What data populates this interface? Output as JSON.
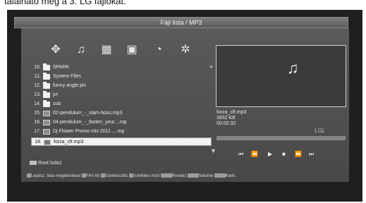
{
  "caption": "található meg a 3. LG fájlokat.",
  "window": {
    "title": "Fájl lista / MP3"
  },
  "filter_icons": [
    {
      "name": "all-files-icon",
      "glyph": "✥"
    },
    {
      "name": "music-icon",
      "glyph": "♫"
    },
    {
      "name": "video-icon",
      "glyph": "▦"
    },
    {
      "name": "photo-icon",
      "glyph": "▣"
    },
    {
      "name": "text-icon",
      "glyph": "◔"
    },
    {
      "name": "settings-icon",
      "glyph": "✲"
    }
  ],
  "files": [
    {
      "num": "10.",
      "type": "folder",
      "name": "SPARK"
    },
    {
      "num": "11.",
      "type": "folder",
      "name": "System Files"
    },
    {
      "num": "12.",
      "type": "folder",
      "name": "funny angle pix"
    },
    {
      "num": "13.",
      "type": "folder",
      "name": "jvr"
    },
    {
      "num": "14.",
      "type": "folder",
      "name": "sub"
    },
    {
      "num": "15.",
      "type": "mp3",
      "name": "02-pendulum_-_slam-boss.mp3"
    },
    {
      "num": "16.",
      "type": "mp3",
      "name": "04-pendulum_-_fasten_your....mp"
    },
    {
      "num": "17.",
      "type": "mp3",
      "name": "Dj Flower Promo mix 2011 ....mp"
    },
    {
      "num": "18.",
      "type": "mp3",
      "name": "forza_cfr.mp3",
      "selected": true
    }
  ],
  "scroll": {
    "up": "▲",
    "down": "▼"
  },
  "now_playing": {
    "file": "forza_cfr.mp3",
    "size": "3652 KB",
    "time": "00:02:32",
    "progress": 0.0
  },
  "brand": "LGL",
  "controls": [
    {
      "name": "prev-track-icon",
      "glyph": "⏮"
    },
    {
      "name": "rewind-icon",
      "glyph": "⏪"
    },
    {
      "name": "play-icon",
      "glyph": "▶"
    },
    {
      "name": "stop-icon",
      "glyph": "■"
    },
    {
      "name": "fast-forward-icon",
      "glyph": "⏩"
    },
    {
      "name": "next-track-icon",
      "glyph": "⏭"
    }
  ],
  "root_label": "Root:\\sda1",
  "legend": [
    {
      "key": "",
      "label": "Lejátsz. lista megtekintése"
    },
    {
      "key": "",
      "label": "FAV All"
    },
    {
      "key": "",
      "label": "Szerkesztés"
    },
    {
      "key": "",
      "label": "Ismétlési mód"
    },
    {
      "key": "",
      "label": "Rendez"
    },
    {
      "key": "",
      "label": "Volume"
    },
    {
      "key": "",
      "label": "Kedv."
    }
  ]
}
